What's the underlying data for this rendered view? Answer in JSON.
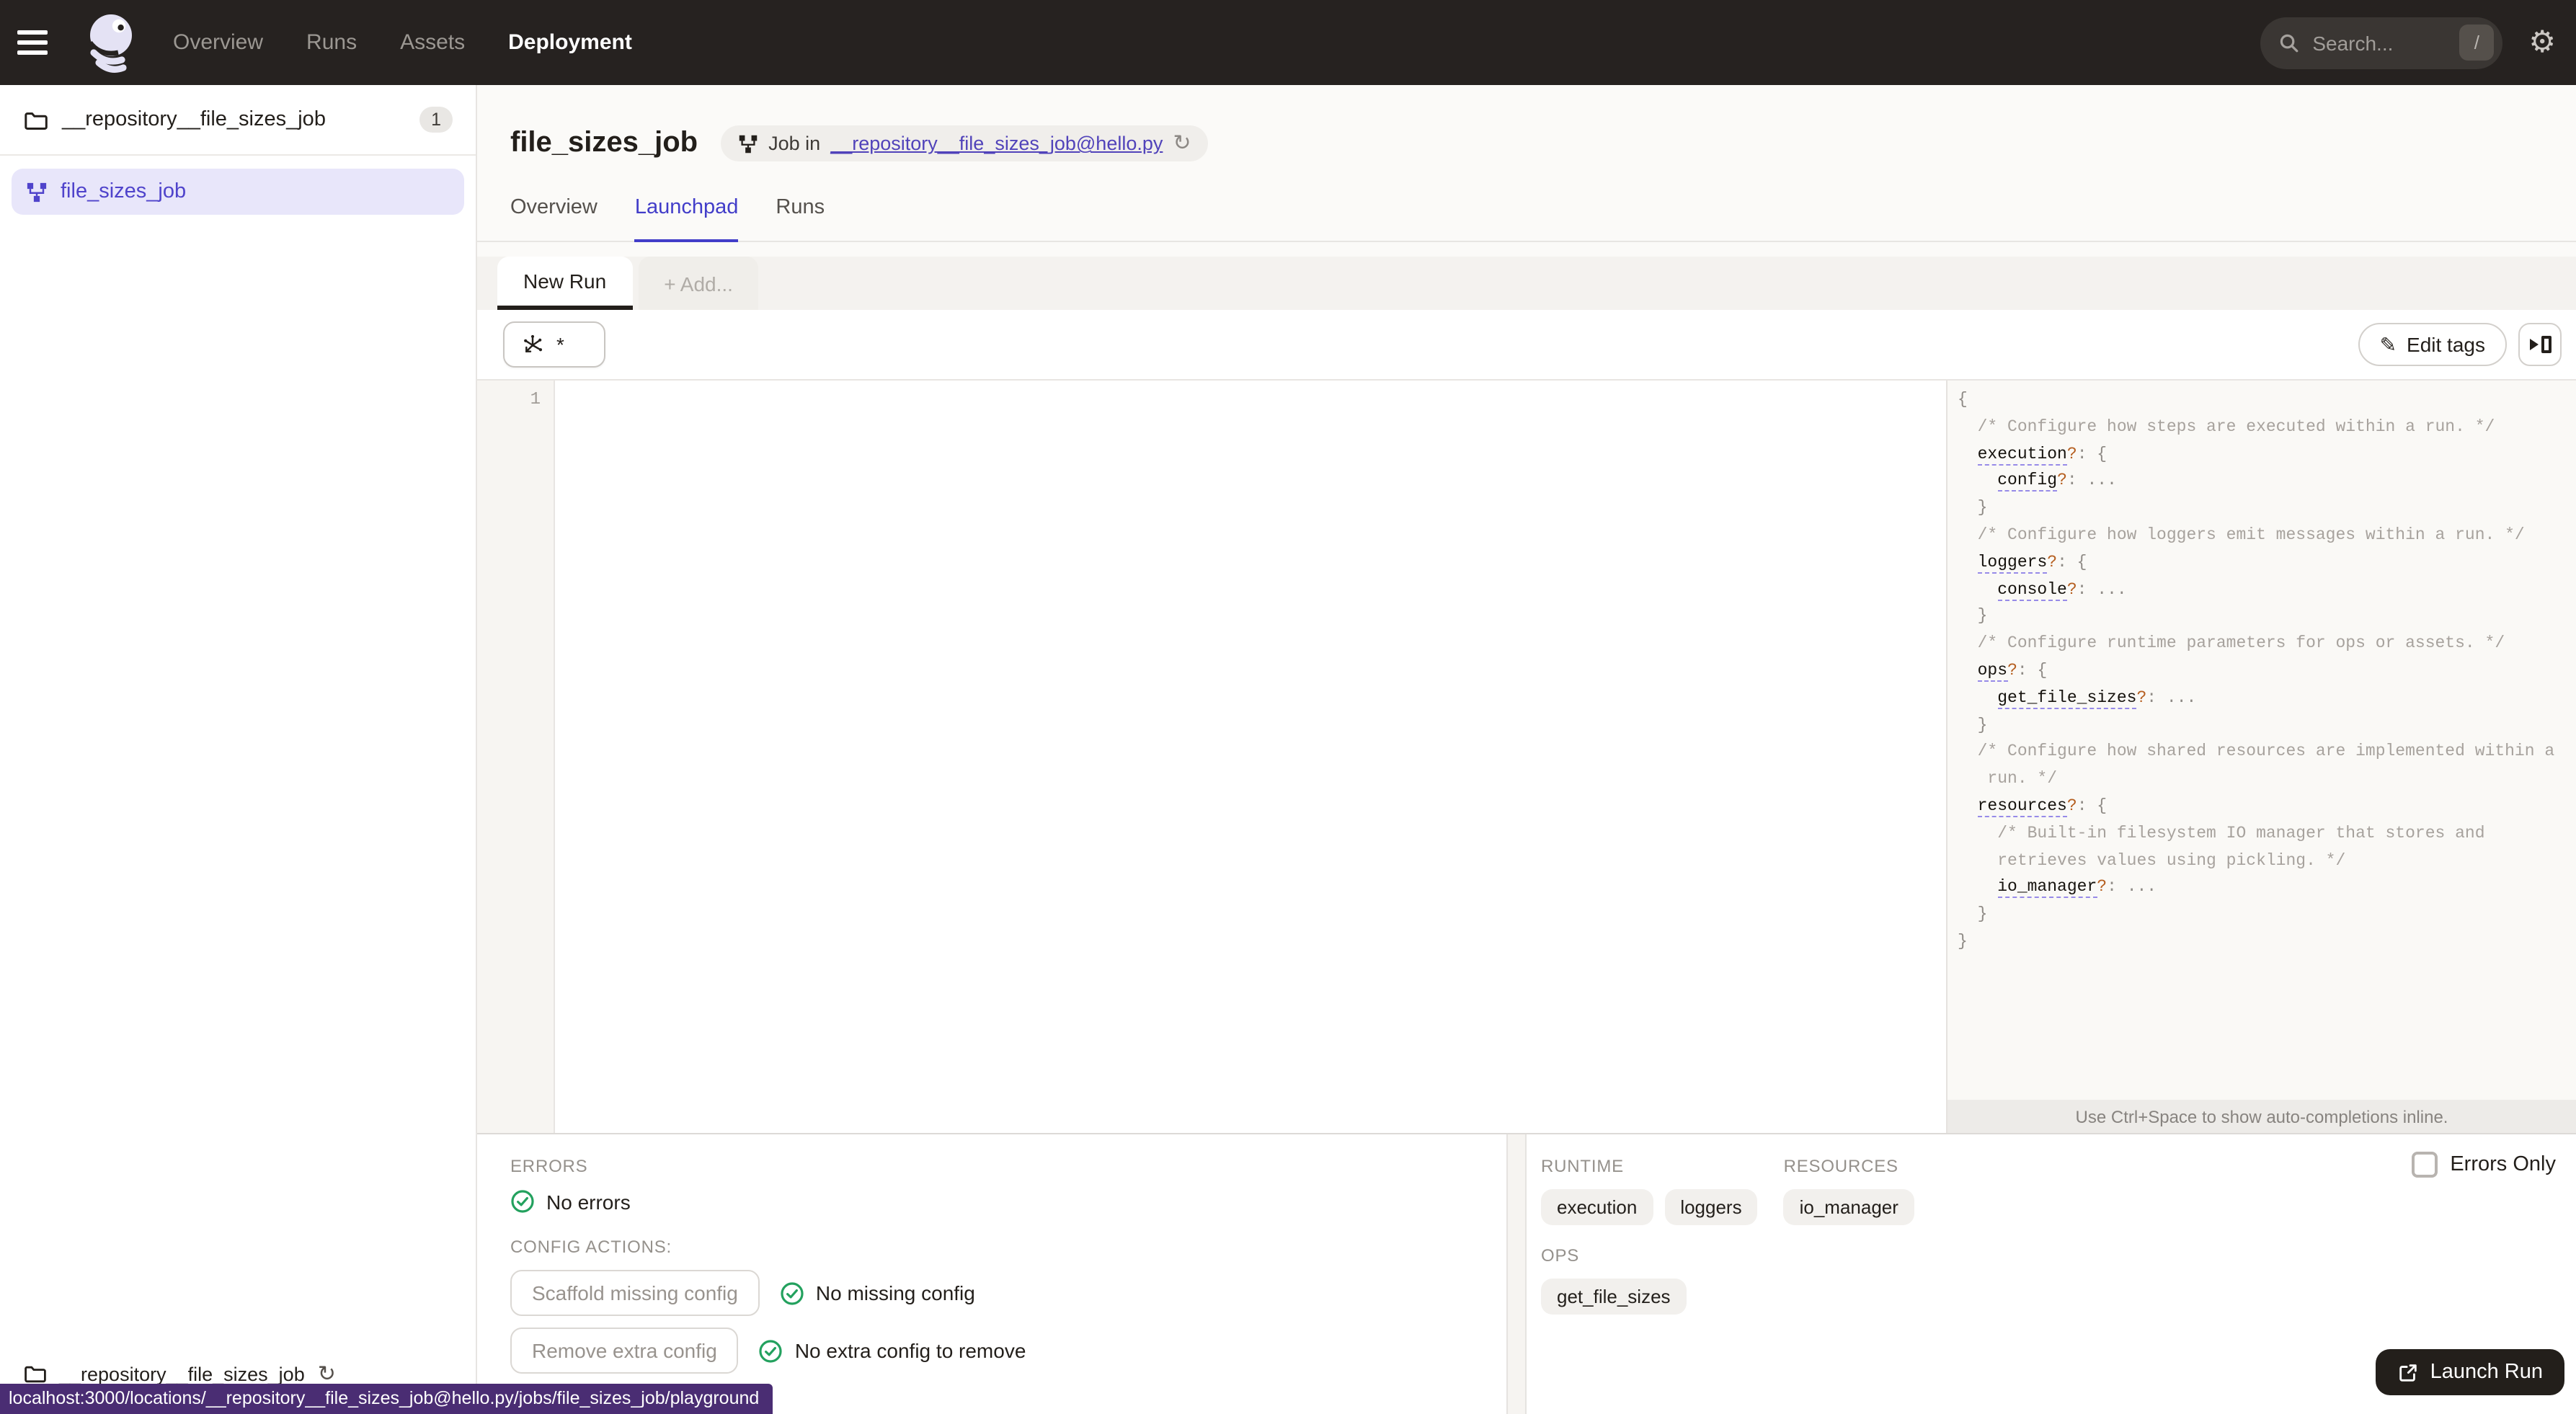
{
  "colors": {
    "nav_dark": "#262220",
    "accent_purple": "#4F43CB",
    "link_purple": "#5143BA",
    "tab_active_purple": "#423DC9",
    "success_green": "#23A15E",
    "statusbar_purple": "#4A2D73",
    "question_mark_orange": "#B55E1F"
  },
  "topnav": {
    "items": [
      {
        "label": "Overview",
        "active": false
      },
      {
        "label": "Runs",
        "active": false
      },
      {
        "label": "Assets",
        "active": false
      },
      {
        "label": "Deployment",
        "active": true
      }
    ],
    "search": {
      "placeholder": "Search...",
      "shortcut": "/"
    }
  },
  "sidebar": {
    "repo": {
      "name": "__repository__file_sizes_job",
      "count": "1"
    },
    "jobs": [
      {
        "name": "file_sizes_job",
        "selected": true
      }
    ],
    "footer": {
      "name": "__repository__file_sizes_job"
    }
  },
  "header": {
    "title": "file_sizes_job",
    "context_pill": {
      "prefix": "Job in",
      "link": "__repository__file_sizes_job@hello.py"
    }
  },
  "tabs": [
    {
      "label": "Overview",
      "active": false
    },
    {
      "label": "Launchpad",
      "active": true
    },
    {
      "label": "Runs",
      "active": false
    }
  ],
  "launchpad": {
    "session_tabs": [
      {
        "label": "New Run",
        "active": true
      },
      {
        "label": "+ Add...",
        "active": false
      }
    ],
    "op_selector_value": "*",
    "edit_tags_label": "Edit tags",
    "editor": {
      "line_number": "1"
    },
    "config_schema": {
      "lines": [
        [
          [
            "p",
            "{"
          ]
        ],
        [
          [
            "c",
            "  /* Configure how steps are executed within a run. */"
          ]
        ],
        [
          [
            "p",
            "  "
          ],
          [
            "k",
            "execution"
          ],
          [
            "q",
            "?"
          ],
          [
            "p",
            ": {"
          ]
        ],
        [
          [
            "p",
            "    "
          ],
          [
            "k",
            "config"
          ],
          [
            "q",
            "?"
          ],
          [
            "p",
            ": "
          ],
          [
            "d",
            "..."
          ]
        ],
        [
          [
            "p",
            "  }"
          ]
        ],
        [
          [
            "c",
            "  /* Configure how loggers emit messages within a run. */"
          ]
        ],
        [
          [
            "p",
            "  "
          ],
          [
            "k",
            "loggers"
          ],
          [
            "q",
            "?"
          ],
          [
            "p",
            ": {"
          ]
        ],
        [
          [
            "p",
            "    "
          ],
          [
            "k",
            "console"
          ],
          [
            "q",
            "?"
          ],
          [
            "p",
            ": "
          ],
          [
            "d",
            "..."
          ]
        ],
        [
          [
            "p",
            "  }"
          ]
        ],
        [
          [
            "c",
            "  /* Configure runtime parameters for ops or assets. */"
          ]
        ],
        [
          [
            "p",
            "  "
          ],
          [
            "k",
            "ops"
          ],
          [
            "q",
            "?"
          ],
          [
            "p",
            ": {"
          ]
        ],
        [
          [
            "p",
            "    "
          ],
          [
            "k",
            "get_file_sizes"
          ],
          [
            "q",
            "?"
          ],
          [
            "p",
            ": "
          ],
          [
            "d",
            "..."
          ]
        ],
        [
          [
            "p",
            "  }"
          ]
        ],
        [
          [
            "c",
            "  /* Configure how shared resources are implemented within a"
          ]
        ],
        [
          [
            "c",
            "   run. */"
          ]
        ],
        [
          [
            "p",
            "  "
          ],
          [
            "k",
            "resources"
          ],
          [
            "q",
            "?"
          ],
          [
            "p",
            ": {"
          ]
        ],
        [
          [
            "c",
            "    /* Built-in filesystem IO manager that stores and"
          ]
        ],
        [
          [
            "c",
            "    retrieves values using pickling. */"
          ]
        ],
        [
          [
            "p",
            "    "
          ],
          [
            "k",
            "io_manager"
          ],
          [
            "q",
            "?"
          ],
          [
            "p",
            ": "
          ],
          [
            "d",
            "..."
          ]
        ],
        [
          [
            "p",
            "  }"
          ]
        ],
        [
          [
            "p",
            "}"
          ]
        ]
      ]
    },
    "hint": "Use Ctrl+Space to show auto-completions inline."
  },
  "bottom_panel": {
    "errors_heading": "ERRORS",
    "errors_status": "No errors",
    "config_actions_heading": "CONFIG ACTIONS:",
    "actions": [
      {
        "button": "Scaffold missing config",
        "status": "No missing config"
      },
      {
        "button": "Remove extra config",
        "status": "No extra config to remove"
      }
    ],
    "errors_only_label": "Errors Only",
    "runtime_heading": "RUNTIME",
    "runtime_tags": [
      "execution",
      "loggers"
    ],
    "resources_heading": "RESOURCES",
    "resources_tags": [
      "io_manager"
    ],
    "ops_heading": "OPS",
    "ops_tags": [
      "get_file_sizes"
    ],
    "launch_button": "Launch Run"
  },
  "statusbar": {
    "url": "localhost:3000/locations/__repository__file_sizes_job@hello.py/jobs/file_sizes_job/playground"
  }
}
